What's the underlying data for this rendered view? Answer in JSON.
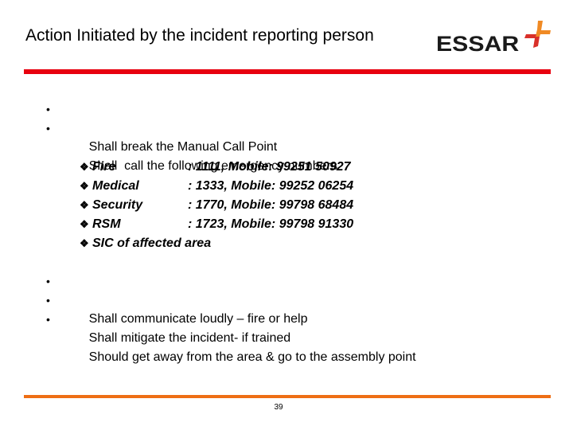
{
  "slide": {
    "title": "Action Initiated by the incident reporting person",
    "logo": {
      "text": "ESSAR",
      "icon": "essar-cross-icon",
      "colors": {
        "text": "#1a1a1a",
        "cross_top": "#f08a24",
        "cross_bottom": "#d9302a"
      }
    },
    "accent_colors": {
      "top_rule": "#e8000f",
      "bottom_rule": "#ee6e14"
    },
    "bullets_top": [
      {
        "bullet": "•",
        "text": "Shall break the Manual Call Point"
      },
      {
        "bullet": "•",
        "text": "Shall  call the following emergency numbers"
      }
    ],
    "contacts_icon": "diamond-bullet-icon",
    "contacts": [
      {
        "marker": "❖",
        "name": "Fire",
        "number": ": 1111, Mobile: 99251 50927"
      },
      {
        "marker": "❖",
        "name": "Medical",
        "number": ": 1333, Mobile: 99252 06254"
      },
      {
        "marker": "❖",
        "name": "Security",
        "number": ": 1770, Mobile: 99798 68484"
      },
      {
        "marker": "❖",
        "name": "RSM",
        "number": ": 1723, Mobile: 99798 91330"
      },
      {
        "marker": "❖",
        "name": "SIC of affected area",
        "number": ""
      }
    ],
    "bullets_bottom": [
      {
        "bullet": "•",
        "text": "Shall communicate loudly – fire or help"
      },
      {
        "bullet": "•",
        "text": "Shall mitigate the incident- if trained"
      },
      {
        "bullet": "•",
        "text": "Should get away from the area & go to the assembly point"
      }
    ],
    "page_number": "39"
  }
}
